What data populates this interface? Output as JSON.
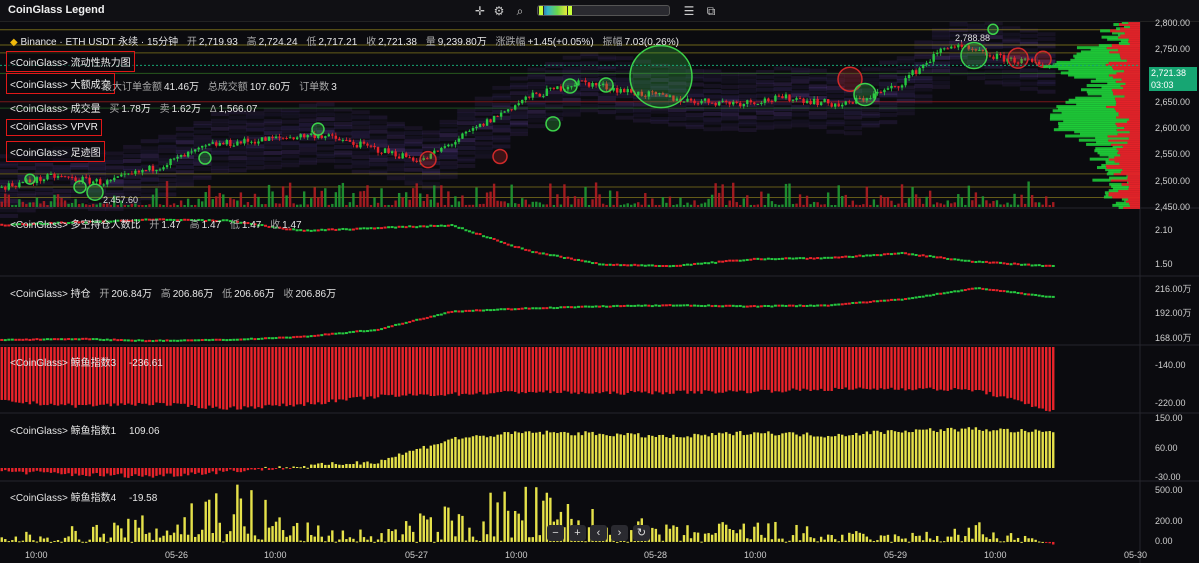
{
  "app": {
    "title": "CoinGlass Legend",
    "toolbar_icons": [
      "crosshair-icon",
      "settings-gear-icon",
      "search-icon",
      "heatmap-range-slider",
      "filter-lines-icon",
      "screenshot-icon"
    ]
  },
  "heatmap_slider": {
    "level": 0.22
  },
  "symbol_header": {
    "exchange_pair": "Binance · ETH USDT 永续 · 15分钟",
    "open_k": "开",
    "open_v": "2,719.93",
    "high_k": "高",
    "high_v": "2,724.24",
    "low_k": "低",
    "low_v": "2,717.21",
    "close_k": "收",
    "close_v": "2,721.38",
    "vol_k": "量",
    "vol_v": "9,239.80万",
    "chg_k": "涨跌幅",
    "chg_v": "+1.45(+0.05%)",
    "amp_k": "振幅",
    "amp_v": "7.03(0.26%)"
  },
  "legend_main": {
    "liquidity": "<CoinGlass> 流动性热力图",
    "big_trades": "<CoinGlass> 大额成交",
    "big_trades_max_k": "最大订单金额",
    "big_trades_max_v": "41.46万",
    "big_trades_total_k": "总成交额",
    "big_trades_total_v": "107.60万",
    "big_trades_count_k": "订单数",
    "big_trades_count_v": "3",
    "volume": "<CoinGlass> 成交量",
    "volume_buy_k": "买",
    "volume_buy_v": "1.78万",
    "volume_sell_k": "卖",
    "volume_sell_v": "1.62万",
    "volume_delta_k": "Δ",
    "volume_delta_v": "1,566.07",
    "vpvr": "<CoinGlass> VPVR",
    "footprint": "<CoinGlass> 足迹图"
  },
  "price_axis": {
    "ticks": [
      "2,800.00",
      "2,750.00",
      "2,700.00",
      "2,650.00",
      "2,600.00",
      "2,550.00",
      "2,500.00",
      "2,450.00"
    ],
    "last_price": "2,721.38",
    "countdown": "03:03",
    "high_label": "2,788.88",
    "low_label": "2,457.60"
  },
  "panes": {
    "ls_ratio": {
      "title": "<CoinGlass> 多空持仓人数比",
      "o_k": "开",
      "o_v": "1.47",
      "h_k": "高",
      "h_v": "1.47",
      "l_k": "低",
      "l_v": "1.47",
      "c_k": "收",
      "c_v": "1.47",
      "ticks": [
        "2.10",
        "1.50"
      ]
    },
    "oi": {
      "title": "<CoinGlass> 持仓",
      "o_k": "开",
      "o_v": "206.84万",
      "h_k": "高",
      "h_v": "206.86万",
      "l_k": "低",
      "l_v": "206.66万",
      "c_k": "收",
      "c_v": "206.86万",
      "ticks": [
        "216.00万",
        "192.00万",
        "168.00万"
      ]
    },
    "whale3": {
      "title": "<CoinGlass> 鲸鱼指数3",
      "value": "-236.61",
      "ticks": [
        "-140.00",
        "-220.00"
      ]
    },
    "whale1": {
      "title": "<CoinGlass> 鲸鱼指数1",
      "value": "109.06",
      "ticks": [
        "150.00",
        "60.00",
        "-30.00"
      ]
    },
    "whale4": {
      "title": "<CoinGlass> 鲸鱼指数4",
      "value": "-19.58",
      "ticks": [
        "500.00",
        "200.00",
        "0.00"
      ]
    }
  },
  "time_axis": [
    "10:00",
    "05-26",
    "10:00",
    "05-27",
    "10:00",
    "05-28",
    "10:00",
    "05-29",
    "10:00",
    "05-30"
  ],
  "nav_buttons": {
    "zoom_out": "−",
    "zoom_in": "+",
    "prev": "‹",
    "next": "›",
    "reset": "↻"
  },
  "colors": {
    "up": "#26c940",
    "down": "#e8232a",
    "yellow": "#e6e24a",
    "bg": "#0b0b0f",
    "heat": "#3a1f5c"
  },
  "chart_data": {
    "type": "line",
    "title": "Binance · ETH USDT 永续 · 15分钟",
    "x_ticks": [
      "10:00",
      "05-26",
      "10:00",
      "05-27",
      "10:00",
      "05-28",
      "10:00",
      "05-29",
      "10:00",
      "05-30"
    ],
    "price_ylim": [
      2450,
      2800
    ],
    "price_path": [
      [
        "05-25 10:00",
        2490
      ],
      [
        "05-25 16:00",
        2510
      ],
      [
        "05-25 22:00",
        2498
      ],
      [
        "05-26 04:00",
        2530
      ],
      [
        "05-26 10:00",
        2570
      ],
      [
        "05-26 16:00",
        2580
      ],
      [
        "05-26 22:00",
        2590
      ],
      [
        "05-27 04:00",
        2565
      ],
      [
        "05-27 10:00",
        2540
      ],
      [
        "05-27 16:00",
        2600
      ],
      [
        "05-27 22:00",
        2660
      ],
      [
        "05-28 04:00",
        2690
      ],
      [
        "05-28 10:00",
        2670
      ],
      [
        "05-28 16:00",
        2655
      ],
      [
        "05-28 22:00",
        2650
      ],
      [
        "05-29 04:00",
        2660
      ],
      [
        "05-29 10:00",
        2645
      ],
      [
        "05-29 16:00",
        2680
      ],
      [
        "05-29 22:00",
        2760
      ],
      [
        "05-30 02:00",
        2735
      ],
      [
        "05-30 05:00",
        2721.38
      ]
    ],
    "ls_ratio_path": [
      2.2,
      2.25,
      2.3,
      2.28,
      2.1,
      2.15,
      2.2,
      1.75,
      1.5,
      1.48,
      1.6,
      1.62,
      1.7,
      1.55,
      1.47
    ],
    "oi_path_wan": [
      165,
      166,
      164,
      165,
      168,
      175,
      193,
      196,
      198,
      199,
      198,
      199,
      205,
      216,
      207
    ],
    "whale3_path": [
      -215,
      -225,
      -220,
      -230,
      -222,
      -205,
      -200,
      -195,
      -198,
      -196,
      -194,
      -190,
      -188,
      -192,
      -236.61
    ],
    "whale1_path": [
      -10,
      -20,
      -25,
      -10,
      5,
      20,
      90,
      110,
      105,
      95,
      110,
      100,
      115,
      120,
      109.06
    ],
    "whale4_path": [
      50,
      120,
      200,
      550,
      150,
      80,
      300,
      450,
      220,
      120,
      180,
      90,
      60,
      150,
      -19.58
    ]
  }
}
